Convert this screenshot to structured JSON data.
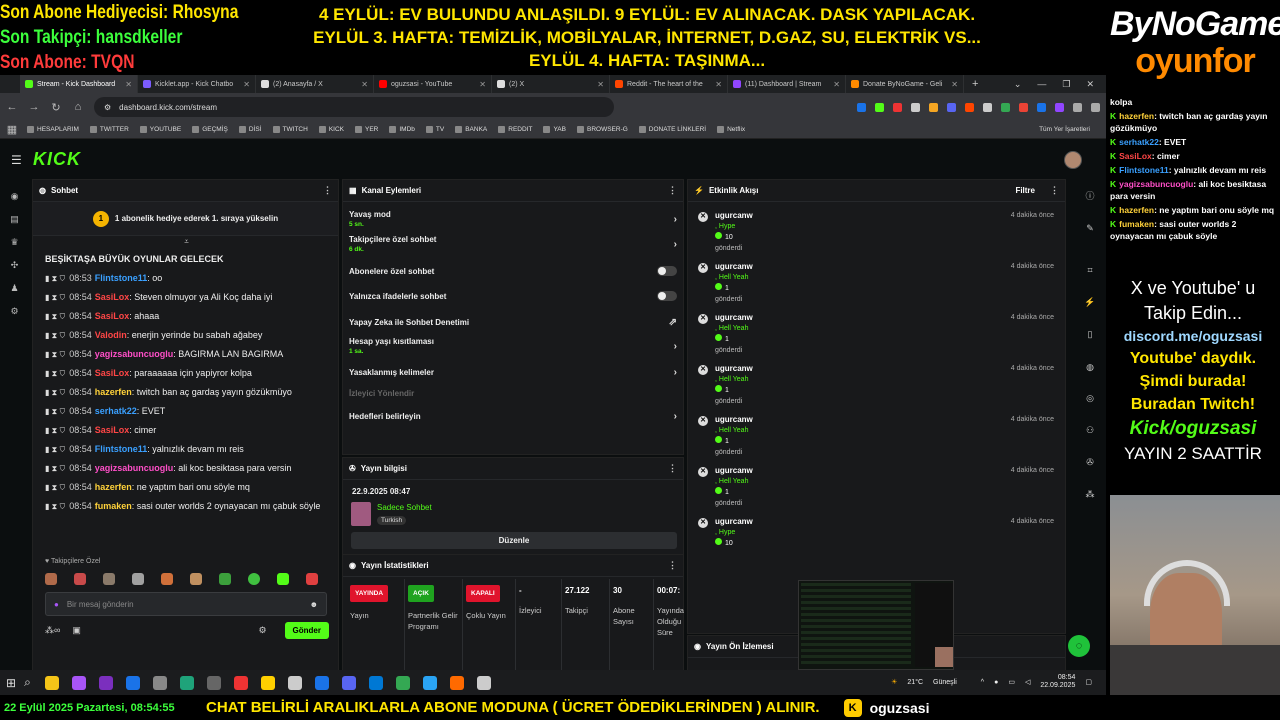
{
  "overlay": {
    "left_lines": [
      {
        "label": "Son Abone Hediyecisi: ",
        "value": "Rhosyna"
      },
      {
        "label": "Son Takipçi: ",
        "value": "hansdkeller"
      },
      {
        "label": "Son Abone: ",
        "value": "TVQN"
      }
    ],
    "center_lines": [
      "4 EYLÜL: EV BULUNDU ANLAŞILDI. 9 EYLÜL: EV ALINACAK. DASK YAPILACAK.",
      "EYLÜL 3. HAFTA: TEMİZLİK, MOBİLYALAR, İNTERNET, D.GAZ, SU, ELEKTRİK VS...",
      "EYLÜL 4. HAFTA: TAŞINMA..."
    ],
    "logo_top": "ByNoGame",
    "logo_bottom": "oyunfor",
    "right_chat": [
      {
        "user": "",
        "text": "kolpa"
      },
      {
        "user": "hazerfen",
        "text": ": twitch ban aç gardaş yayın gözükmüyo",
        "color": "#ffd23a"
      },
      {
        "user": "serhatk22",
        "text": ": EVET",
        "color": "#3aa0ff"
      },
      {
        "user": "SasiLox",
        "text": ": cimer",
        "color": "#ff4646"
      },
      {
        "user": "Flintstone11",
        "text": ": yalnızlık devam mı reis",
        "color": "#3aa0ff"
      },
      {
        "user": "yagizsabuncuoglu",
        "text": ": ali koc besiktasa para versin",
        "color": "#ff4fc8"
      },
      {
        "user": "hazerfen",
        "text": ": ne yaptım bari onu söyle mq",
        "color": "#ffd23a"
      },
      {
        "user": "fumaken",
        "text": ": sasi outer worlds 2 oynayacan mı çabuk söyle",
        "color": "#ffd23a"
      }
    ],
    "right_texts": [
      {
        "text": "X ve Youtube' u",
        "color": "#ffffff",
        "size": 18,
        "weight": "normal",
        "style": "normal"
      },
      {
        "text": "Takip Edin...",
        "color": "#ffffff",
        "size": 18,
        "weight": "normal",
        "style": "normal"
      },
      {
        "text": "discord.me/oguzsasi",
        "color": "#9fd8ff",
        "size": 14,
        "weight": "bold",
        "style": "normal"
      },
      {
        "text": "Youtube' daydık.",
        "color": "#ffe600",
        "size": 16,
        "weight": "bold",
        "style": "normal"
      },
      {
        "text": "Şimdi burada!",
        "color": "#ffe600",
        "size": 16,
        "weight": "bold",
        "style": "normal"
      },
      {
        "text": "Buradan Twitch!",
        "color": "#ffe600",
        "size": 16,
        "weight": "bold",
        "style": "normal"
      },
      {
        "text": "Kick/oguzsasi",
        "color": "#53fc18",
        "size": 19,
        "weight": "bold",
        "style": "italic"
      },
      {
        "text": "YAYIN 2 SAATTİR",
        "color": "#ffffff",
        "size": 17,
        "weight": "normal",
        "style": "normal"
      }
    ],
    "bottom_date": "22 Eylül 2025 Pazartesi, 08:54:55",
    "bottom_message": "CHAT BELİRLİ ARALIKLARLA ABONE MODUNA ( ÜCRET ÖDEDİKLERİNDEN ) ALINIR.",
    "bottom_channel": "oguzsasi"
  },
  "browser": {
    "tabs": [
      {
        "label": "Stream - Kick Dashboard",
        "color": "#53fc18",
        "active": true
      },
      {
        "label": "Kicklet.app - Kick Chatbo",
        "color": "#7c5cff"
      },
      {
        "label": "(2) Anasayfa / X",
        "color": "#dddddd"
      },
      {
        "label": "oguzsasi - YouTube",
        "color": "#ff0000"
      },
      {
        "label": "(2) X",
        "color": "#dddddd"
      },
      {
        "label": "Reddit - The heart of the",
        "color": "#ff4500"
      },
      {
        "label": "(11) Dashboard | Stream",
        "color": "#9146ff"
      },
      {
        "label": "Donate ByNoGame - Geli",
        "color": "#ff8a00"
      }
    ],
    "url": "dashboard.kick.com/stream",
    "bookmarks": [
      "HESAPLARIM",
      "TWITTER",
      "YOUTUBE",
      "GEÇMİŞ",
      "DİSİ",
      "TWITCH",
      "KICK",
      "YER",
      "IMDb",
      "TV",
      "BANKA",
      "REDDIT",
      "YAB",
      "BROWSER-G",
      "DONATE LİNKLERİ",
      "Netflix"
    ],
    "all_bookmarks": "Tüm Yer İşaretleri"
  },
  "kick": {
    "logo": "KICK",
    "chat": {
      "title": "Sohbet",
      "gift_count": "1",
      "gift_text": "1 abonelik hediye ederek 1. sıraya yükselin",
      "first_line": "BEŞİKTAŞA BÜYÜK OYUNLAR GELECEK",
      "messages": [
        {
          "time": "08:53",
          "user": "Flintstone11",
          "cls": "u-blue",
          "text": ": oo"
        },
        {
          "time": "08:54",
          "user": "SasiLox",
          "cls": "u-red",
          "text": ": Steven olmuyor ya Ali Koç daha iyi"
        },
        {
          "time": "08:54",
          "user": "SasiLox",
          "cls": "u-red",
          "text": ": ahaaa"
        },
        {
          "time": "08:54",
          "user": "Valodin",
          "cls": "u-red",
          "text": ": enerjin yerinde bu sabah ağabey"
        },
        {
          "time": "08:54",
          "user": "yagizsabuncuoglu",
          "cls": "u-pink",
          "text": ": BAGIRMA LAN BAGIRMA"
        },
        {
          "time": "08:54",
          "user": "SasiLox",
          "cls": "u-red",
          "text": ": paraaaaaa için yapiyror kolpa"
        },
        {
          "time": "08:54",
          "user": "hazerfen",
          "cls": "u-yel",
          "text": ": twitch ban aç gardaş yayın gözükmüyo"
        },
        {
          "time": "08:54",
          "user": "serhatk22",
          "cls": "u-blue",
          "text": ": EVET"
        },
        {
          "time": "08:54",
          "user": "SasiLox",
          "cls": "u-red",
          "text": ": cimer"
        },
        {
          "time": "08:54",
          "user": "Flintstone11",
          "cls": "u-blue",
          "text": ": yalnızlık devam mı reis"
        },
        {
          "time": "08:54",
          "user": "yagizsabuncuoglu",
          "cls": "u-pink",
          "text": ": ali koc besiktasa para versin"
        },
        {
          "time": "08:54",
          "user": "hazerfen",
          "cls": "u-yel",
          "text": ": ne yaptım bari onu söyle mq"
        },
        {
          "time": "08:54",
          "user": "fumaken",
          "cls": "u-yel",
          "text": ": sasi outer worlds 2 oynayacan mı çabuk söyle"
        }
      ],
      "followers_only": "Takipçilere Özel",
      "input_placeholder": "Bir mesaj gönderin",
      "send": "Gönder"
    },
    "actions": {
      "title": "Kanal Eylemleri",
      "items": [
        {
          "label": "Yavaş mod",
          "sub": "5 sn.",
          "kind": "chev"
        },
        {
          "label": "Takipçilere özel sohbet",
          "sub": "6 dk.",
          "kind": "chev"
        },
        {
          "label": "Abonelere özel sohbet",
          "sub": "",
          "kind": "toggle"
        },
        {
          "label": "Yalnızca ifadelerle sohbet",
          "sub": "",
          "kind": "toggle"
        },
        {
          "label": "Yapay Zeka ile Sohbet Denetimi",
          "sub": "",
          "kind": "ext"
        },
        {
          "label": "Hesap yaşı kısıtlaması",
          "sub": "1 sa.",
          "kind": "chev"
        },
        {
          "label": "Yasaklanmış kelimeler",
          "sub": "",
          "kind": "chev"
        },
        {
          "label": "İzleyici Yönlendir",
          "sub": "",
          "kind": "dim"
        },
        {
          "label": "Hedefleri belirleyin",
          "sub": "",
          "kind": "chev"
        }
      ]
    },
    "stream_info": {
      "title": "Yayın bilgisi",
      "date": "22.9.2025 08:47",
      "category": "Sadece Sohbet",
      "tag": "Turkish",
      "edit": "Düzenle"
    },
    "stats": {
      "title": "Yayın İstatistikleri",
      "columns": [
        {
          "pill": "YAYINDA",
          "pill_color": "#e0142c",
          "label": "Yayın"
        },
        {
          "pill": "AÇIK",
          "pill_color": "#1fa31f",
          "label": "Partnerlik Gelir Programı"
        },
        {
          "pill": "KAPALI",
          "pill_color": "#e0142c",
          "label": "Çoklu Yayın"
        },
        {
          "value": "-",
          "label": "İzleyici"
        },
        {
          "value": "27.122",
          "label": "Takipçi"
        },
        {
          "value": "30",
          "label": "Abone Sayısı"
        },
        {
          "value": "00:07:",
          "label": "Yayında Olduğu Süre"
        }
      ]
    },
    "activity": {
      "title": "Etkinlik Akışı",
      "filter": "Filtre",
      "items": [
        {
          "user": "ugurcanw",
          "reward": ", Hype",
          "count": "10",
          "sent": "gönderdi",
          "time": "4 dakika önce"
        },
        {
          "user": "ugurcanw",
          "reward": ", Hell Yeah",
          "count": "1",
          "sent": "gönderdi",
          "time": "4 dakika önce"
        },
        {
          "user": "ugurcanw",
          "reward": ", Hell Yeah",
          "count": "1",
          "sent": "gönderdi",
          "time": "4 dakika önce"
        },
        {
          "user": "ugurcanw",
          "reward": ", Hell Yeah",
          "count": "1",
          "sent": "gönderdi",
          "time": "4 dakika önce"
        },
        {
          "user": "ugurcanw",
          "reward": ", Hell Yeah",
          "count": "1",
          "sent": "gönderdi",
          "time": "4 dakika önce"
        },
        {
          "user": "ugurcanw",
          "reward": ", Hell Yeah",
          "count": "1",
          "sent": "gönderdi",
          "time": "4 dakika önce"
        },
        {
          "user": "ugurcanw",
          "reward": ", Hype",
          "count": "10",
          "sent": "",
          "time": "4 dakika önce"
        }
      ]
    },
    "preview": {
      "title": "Yayın Ön İzlemesi"
    }
  },
  "taskbar": {
    "weather": "21°C",
    "weather_label": "Güneşli",
    "time": "08:54",
    "date": "22.09.2025"
  }
}
